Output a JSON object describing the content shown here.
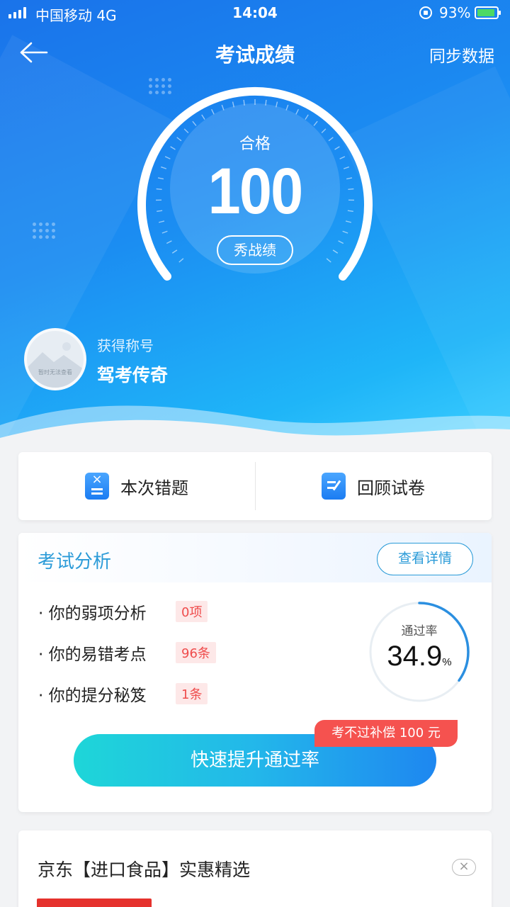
{
  "status_bar": {
    "carrier": "中国移动  4G",
    "time": "14:04",
    "battery": "93%"
  },
  "nav": {
    "title": "考试成绩",
    "sync": "同步数据"
  },
  "score": {
    "label": "合格",
    "value": "100",
    "show_button": "秀战绩"
  },
  "honor": {
    "label": "获得称号",
    "value": "驾考传奇",
    "avatar_text": "暂时无法查看"
  },
  "actions": {
    "wrong": "本次错题",
    "review": "回顾试卷"
  },
  "analysis": {
    "title": "考试分析",
    "detail_button": "查看详情",
    "rows": [
      {
        "label": "· 你的弱项分析",
        "badge": "0项"
      },
      {
        "label": "· 你的易错考点",
        "badge": "96条"
      },
      {
        "label": "· 你的提分秘笈",
        "badge": "1条"
      }
    ],
    "pass_rate_label": "通过率",
    "pass_rate_value": "34.9",
    "pass_rate_unit": "%",
    "pass_rate_fraction": 0.349,
    "boost_button": "快速提升通过率",
    "promo": "考不过补偿 100 元"
  },
  "ad": {
    "title": "京东【进口食品】实惠精选",
    "close": "×"
  },
  "colors": {
    "primary": "#1b8df2",
    "accent": "#2b9bd8",
    "badge": "#ef4c4c",
    "promo": "#f5524f"
  }
}
